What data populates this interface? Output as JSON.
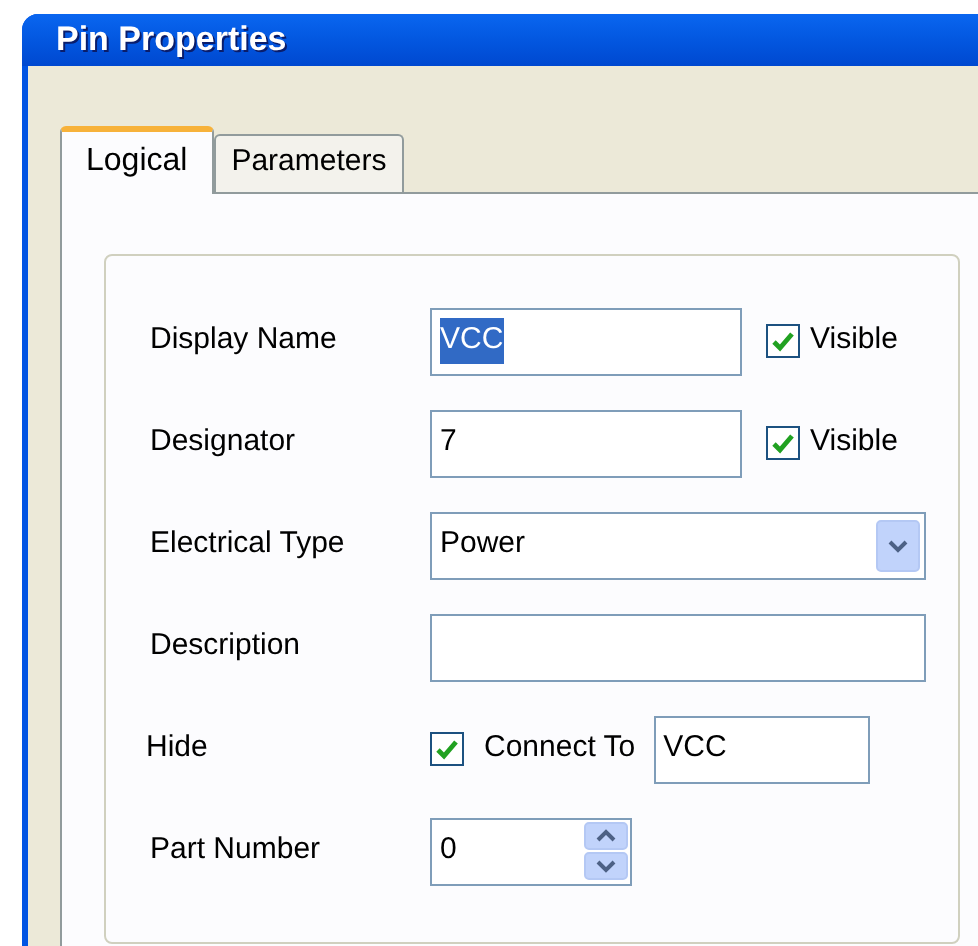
{
  "window": {
    "title": "Pin Properties"
  },
  "tabs": [
    {
      "label": "Logical",
      "selected": true
    },
    {
      "label": "Parameters",
      "selected": false
    }
  ],
  "rows": [
    {
      "kind": "text",
      "label": "Display Name",
      "value": "VCC",
      "text_selected": true,
      "visible": {
        "label": "Visible",
        "checked": true
      }
    },
    {
      "kind": "text",
      "label": "Designator",
      "value": "7",
      "text_selected": false,
      "visible": {
        "label": "Visible",
        "checked": true
      }
    },
    {
      "kind": "select",
      "label": "Electrical Type",
      "value": "Power"
    },
    {
      "kind": "text",
      "label": "Description"
    },
    {
      "kind": "hide",
      "label": "Hide",
      "checked": true,
      "connect_label": "Connect To",
      "value": "VCC"
    },
    {
      "kind": "spin",
      "label": "Part Number",
      "value": "0"
    }
  ]
}
